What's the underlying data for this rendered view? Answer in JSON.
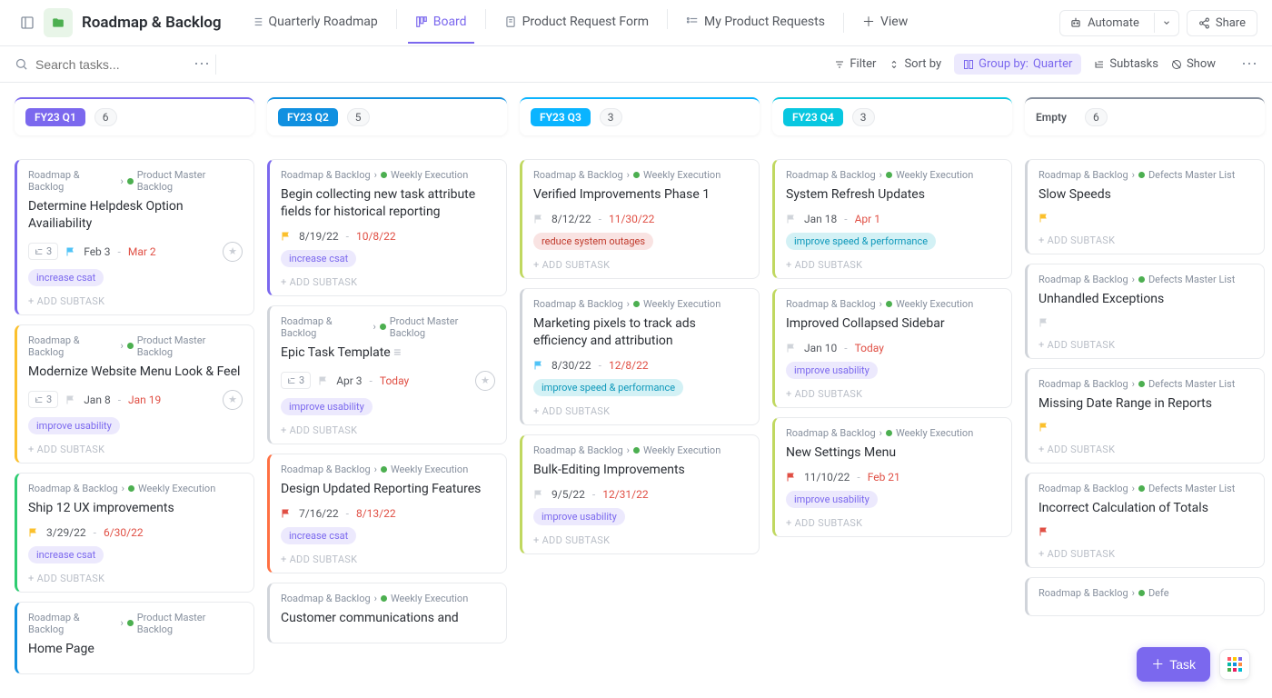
{
  "header": {
    "title": "Roadmap & Backlog",
    "tabs": [
      {
        "label": "Quarterly Roadmap",
        "icon": "list"
      },
      {
        "label": "Board",
        "icon": "board",
        "active": true
      },
      {
        "label": "Product Request Form",
        "icon": "form"
      },
      {
        "label": "My Product Requests",
        "icon": "mylist"
      }
    ],
    "add_view": "View",
    "automate": "Automate",
    "share": "Share"
  },
  "toolbar": {
    "search_placeholder": "Search tasks...",
    "filter": "Filter",
    "sort": "Sort by",
    "group_label": "Group by:",
    "group_value": "Quarter",
    "subtasks": "Subtasks",
    "show": "Show"
  },
  "columns": [
    {
      "name": "FY23 Q1",
      "count": "6",
      "style": "q1",
      "badge_color": "#7b68ee",
      "cards": [
        {
          "border": "#7b68ee",
          "crumbs": [
            "Roadmap & Backlog",
            "Product Master Backlog"
          ],
          "crumb_dot": "#4caf50",
          "title": "Determine Helpdesk Option Availiability",
          "sub": "3",
          "flag_color": "#4fc3f7",
          "start": "Feb 3",
          "end": "Mar 2",
          "star": true,
          "tags": [
            {
              "text": "increase csat",
              "cls": "tag-purple"
            }
          ],
          "add": "+ ADD SUBTASK"
        },
        {
          "border": "#fbc02d",
          "crumbs": [
            "Roadmap & Backlog",
            "Product Master Backlog"
          ],
          "crumb_dot": "#4caf50",
          "title": "Modernize Website Menu Look & Feel",
          "sub": "3",
          "flag_color": "#d0d4da",
          "start": "Jan 8",
          "end": "Jan 19",
          "star": true,
          "tags": [
            {
              "text": "improve usability",
              "cls": "tag-purple"
            }
          ],
          "add": "+ ADD SUBTASK"
        },
        {
          "border": "#2ecc71",
          "crumbs": [
            "Roadmap & Backlog",
            "Weekly Execution"
          ],
          "crumb_dot": "#4caf50",
          "title": "Ship 12 UX improvements",
          "flag_color": "#fbc02d",
          "start": "3/29/22",
          "end": "6/30/22",
          "tags": [
            {
              "text": "increase csat",
              "cls": "tag-purple"
            }
          ],
          "add": "+ ADD SUBTASK"
        },
        {
          "border": "#1090e0",
          "crumbs": [
            "Roadmap & Backlog",
            "Product Master Backlog"
          ],
          "crumb_dot": "#4caf50",
          "title": "Home Page"
        }
      ]
    },
    {
      "name": "FY23 Q2",
      "count": "5",
      "style": "q2",
      "badge_color": "#1090e0",
      "cards": [
        {
          "border": "#7b68ee",
          "crumbs": [
            "Roadmap & Backlog",
            "Weekly Execution"
          ],
          "crumb_dot": "#4caf50",
          "title": "Begin collecting new task attribute fields for historical reporting",
          "flag_color": "#fbc02d",
          "start": "8/19/22",
          "end": "10/8/22",
          "tags": [
            {
              "text": "increase csat",
              "cls": "tag-purple"
            }
          ],
          "add": "+ ADD SUBTASK"
        },
        {
          "border": "#d0d4da",
          "crumbs": [
            "Roadmap & Backlog",
            "Product Master Backlog"
          ],
          "crumb_dot": "#4caf50",
          "title": "Epic Task Template",
          "desc_icon": true,
          "sub": "3",
          "flag_color": "#d0d4da",
          "start": "Apr 3",
          "end": "Today",
          "star": true,
          "tags": [
            {
              "text": "improve usability",
              "cls": "tag-purple"
            }
          ],
          "add": "+ ADD SUBTASK"
        },
        {
          "border": "#ff7043",
          "crumbs": [
            "Roadmap & Backlog",
            "Weekly Execution"
          ],
          "crumb_dot": "#4caf50",
          "title": "Design Updated Reporting Features",
          "flag_color": "#e04f44",
          "start": "7/16/22",
          "end": "8/13/22",
          "tags": [
            {
              "text": "increase csat",
              "cls": "tag-purple"
            }
          ],
          "add": "+ ADD SUBTASK"
        },
        {
          "border": "#d0d4da",
          "crumbs": [
            "Roadmap & Backlog",
            "Weekly Execution"
          ],
          "crumb_dot": "#4caf50",
          "title": "Customer communications and"
        }
      ]
    },
    {
      "name": "FY23 Q3",
      "count": "3",
      "style": "q3",
      "badge_color": "#0ab4ff",
      "cards": [
        {
          "border": "#c0d860",
          "crumbs": [
            "Roadmap & Backlog",
            "Weekly Execution"
          ],
          "crumb_dot": "#4caf50",
          "title": "Verified Improvements Phase 1",
          "flag_color": "#d0d4da",
          "start": "8/12/22",
          "end": "11/30/22",
          "tags": [
            {
              "text": "reduce system outages",
              "cls": "tag-red"
            }
          ],
          "add": "+ ADD SUBTASK"
        },
        {
          "border": "#d0d4da",
          "crumbs": [
            "Roadmap & Backlog",
            "Weekly Execution"
          ],
          "crumb_dot": "#4caf50",
          "title": "Marketing pixels to track ads efficiency and attribution",
          "flag_color": "#4fc3f7",
          "start": "8/30/22",
          "end": "12/8/22",
          "tags": [
            {
              "text": "improve speed & performance",
              "cls": "tag-cyan"
            }
          ],
          "add": "+ ADD SUBTASK"
        },
        {
          "border": "#c0d860",
          "crumbs": [
            "Roadmap & Backlog",
            "Weekly Execution"
          ],
          "crumb_dot": "#4caf50",
          "title": "Bulk-Editing Improvements",
          "flag_color": "#d0d4da",
          "start": "9/5/22",
          "end": "12/31/22",
          "tags": [
            {
              "text": "improve usability",
              "cls": "tag-purple"
            }
          ],
          "add": "+ ADD SUBTASK"
        }
      ]
    },
    {
      "name": "FY23 Q4",
      "count": "3",
      "style": "q4",
      "badge_color": "#08c7e0",
      "cards": [
        {
          "border": "#c0d860",
          "crumbs": [
            "Roadmap & Backlog",
            "Weekly Execution"
          ],
          "crumb_dot": "#4caf50",
          "title": "System Refresh Updates",
          "flag_color": "#d0d4da",
          "start": "Jan 18",
          "end": "Apr 1",
          "tags": [
            {
              "text": "improve speed & performance",
              "cls": "tag-cyan"
            }
          ],
          "add": "+ ADD SUBTASK"
        },
        {
          "border": "#c0d860",
          "crumbs": [
            "Roadmap & Backlog",
            "Weekly Execution"
          ],
          "crumb_dot": "#4caf50",
          "title": "Improved Collapsed Sidebar",
          "flag_color": "#d0d4da",
          "start": "Jan 10",
          "end": "Today",
          "tags": [
            {
              "text": "improve usability",
              "cls": "tag-purple"
            }
          ],
          "add": "+ ADD SUBTASK"
        },
        {
          "border": "#c0d860",
          "crumbs": [
            "Roadmap & Backlog",
            "Weekly Execution"
          ],
          "crumb_dot": "#4caf50",
          "title": "New Settings Menu",
          "flag_color": "#e04f44",
          "start": "11/10/22",
          "end": "Feb 21",
          "tags": [
            {
              "text": "improve usability",
              "cls": "tag-purple"
            }
          ],
          "add": "+ ADD SUBTASK"
        }
      ]
    },
    {
      "name": "Empty",
      "count": "6",
      "style": "empty",
      "badge_color": "#87909e",
      "cards": [
        {
          "border": "#d0d4da",
          "crumbs": [
            "Roadmap & Backlog",
            "Defects Master List"
          ],
          "crumb_dot": "#4caf50",
          "title": "Slow Speeds",
          "flag_color": "#fbc02d",
          "add": "+ ADD SUBTASK"
        },
        {
          "border": "#d0d4da",
          "crumbs": [
            "Roadmap & Backlog",
            "Defects Master List"
          ],
          "crumb_dot": "#4caf50",
          "title": "Unhandled Exceptions",
          "flag_color": "#d0d4da",
          "add": "+ ADD SUBTASK"
        },
        {
          "border": "#d0d4da",
          "crumbs": [
            "Roadmap & Backlog",
            "Defects Master List"
          ],
          "crumb_dot": "#4caf50",
          "title": "Missing Date Range in Reports",
          "flag_color": "#fbc02d",
          "add": "+ ADD SUBTASK"
        },
        {
          "border": "#d0d4da",
          "crumbs": [
            "Roadmap & Backlog",
            "Defects Master List"
          ],
          "crumb_dot": "#4caf50",
          "title": "Incorrect Calculation of Totals",
          "flag_color": "#e04f44",
          "add": "+ ADD SUBTASK"
        },
        {
          "border": "#d0d4da",
          "crumbs": [
            "Roadmap & Backlog",
            "Defe"
          ],
          "crumb_dot": "#4caf50",
          "title": ""
        }
      ]
    }
  ],
  "fab": {
    "task": "Task"
  }
}
